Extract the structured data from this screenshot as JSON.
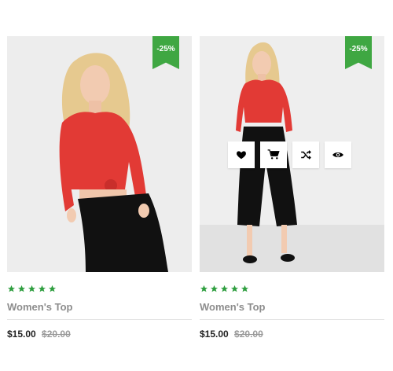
{
  "products": [
    {
      "badge": "-25%",
      "rating": 5,
      "name": "Women's Top",
      "price": "$15.00",
      "old_price": "$20.00",
      "image": "woman in red long-sleeve top and black culottes, cropped"
    },
    {
      "badge": "-25%",
      "rating": 5,
      "name": "Women's Top",
      "price": "$15.00",
      "old_price": "$20.00",
      "image": "woman in red long-sleeve top and black culottes, full length",
      "actions": [
        "heart-icon",
        "cart-icon",
        "shuffle-icon",
        "eye-icon"
      ]
    }
  ],
  "colors": {
    "badge": "#3fa742",
    "star": "#2e9e3f",
    "top": "#e23a35",
    "pants": "#111111"
  }
}
